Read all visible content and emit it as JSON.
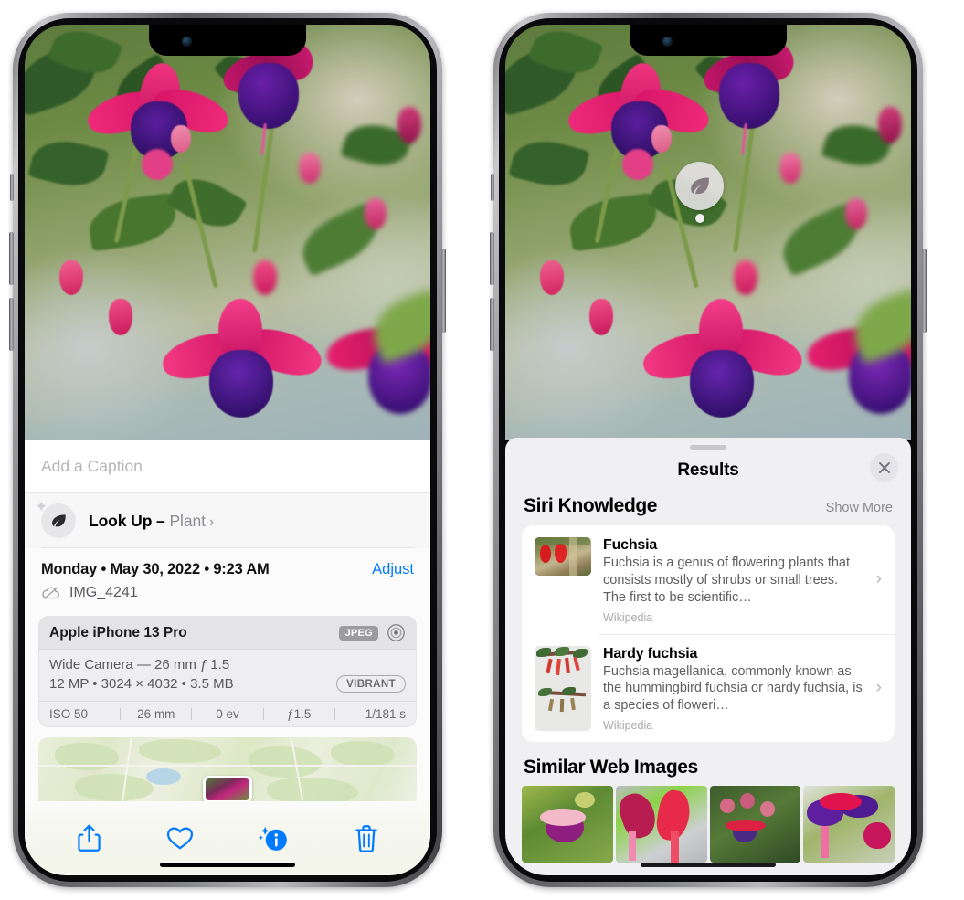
{
  "left_phone": {
    "caption": {
      "placeholder": "Add a Caption",
      "value": ""
    },
    "lookup": {
      "label": "Look Up",
      "dash": " – ",
      "subject": "Plant",
      "chevron": "›",
      "icon": "leaf-icon",
      "sparkle": "✦"
    },
    "metadata": {
      "date_line": "Monday • May 30, 2022 • 9:23 AM",
      "adjust_label": "Adjust",
      "filename": "IMG_4241",
      "cloud_icon": "icloud-slash-icon"
    },
    "camera_card": {
      "model": "Apple iPhone 13 Pro",
      "format_badge": "JPEG",
      "aperture_icon": "aperture-icon",
      "lens_line": "Wide Camera — 26 mm ƒ 1.5",
      "size_line": "12 MP • 3024 × 4032 • 3.5 MB",
      "style_badge": "VIBRANT",
      "exif": [
        "ISO 50",
        "26 mm",
        "0 ev",
        "ƒ1.5",
        "1/181 s"
      ]
    },
    "toolbar": [
      {
        "name": "share-button",
        "icon": "share-icon"
      },
      {
        "name": "favorite-button",
        "icon": "heart-icon"
      },
      {
        "name": "info-button",
        "icon": "info-sparkle-icon"
      },
      {
        "name": "delete-button",
        "icon": "trash-icon"
      }
    ]
  },
  "right_phone": {
    "visual_lookup_badge": {
      "icon": "leaf-icon"
    },
    "sheet": {
      "title": "Results",
      "close_icon": "close-icon",
      "sections": [
        {
          "title": "Siri Knowledge",
          "action": "Show More",
          "items": [
            {
              "title": "Fuchsia",
              "description": "Fuchsia is a genus of flowering plants that consists mostly of shrubs or small trees. The first to be scientific…",
              "source": "Wikipedia",
              "chevron": "›",
              "thumb": "fuchsia-red-flowers-thumbnail"
            },
            {
              "title": "Hardy fuchsia",
              "description": "Fuchsia magellanica, commonly known as the hummingbird fuchsia or hardy fuchsia, is a species of floweri…",
              "source": "Wikipedia",
              "chevron": "›",
              "thumb": "fuchsia-magellanica-specimen-thumbnail"
            }
          ]
        },
        {
          "title": "Similar Web Images",
          "images": [
            "fuchsia-pink-purple-on-green",
            "fuchsia-red-closeup",
            "fuchsia-bush-red-purple",
            "fuchsia-purple-magenta-cluster"
          ]
        }
      ]
    }
  },
  "colors": {
    "accent_blue": "#007aff",
    "sheet_bg": "#f0f0f3",
    "card_bg": "#ffffff",
    "muted_text": "#8a8a8f"
  }
}
